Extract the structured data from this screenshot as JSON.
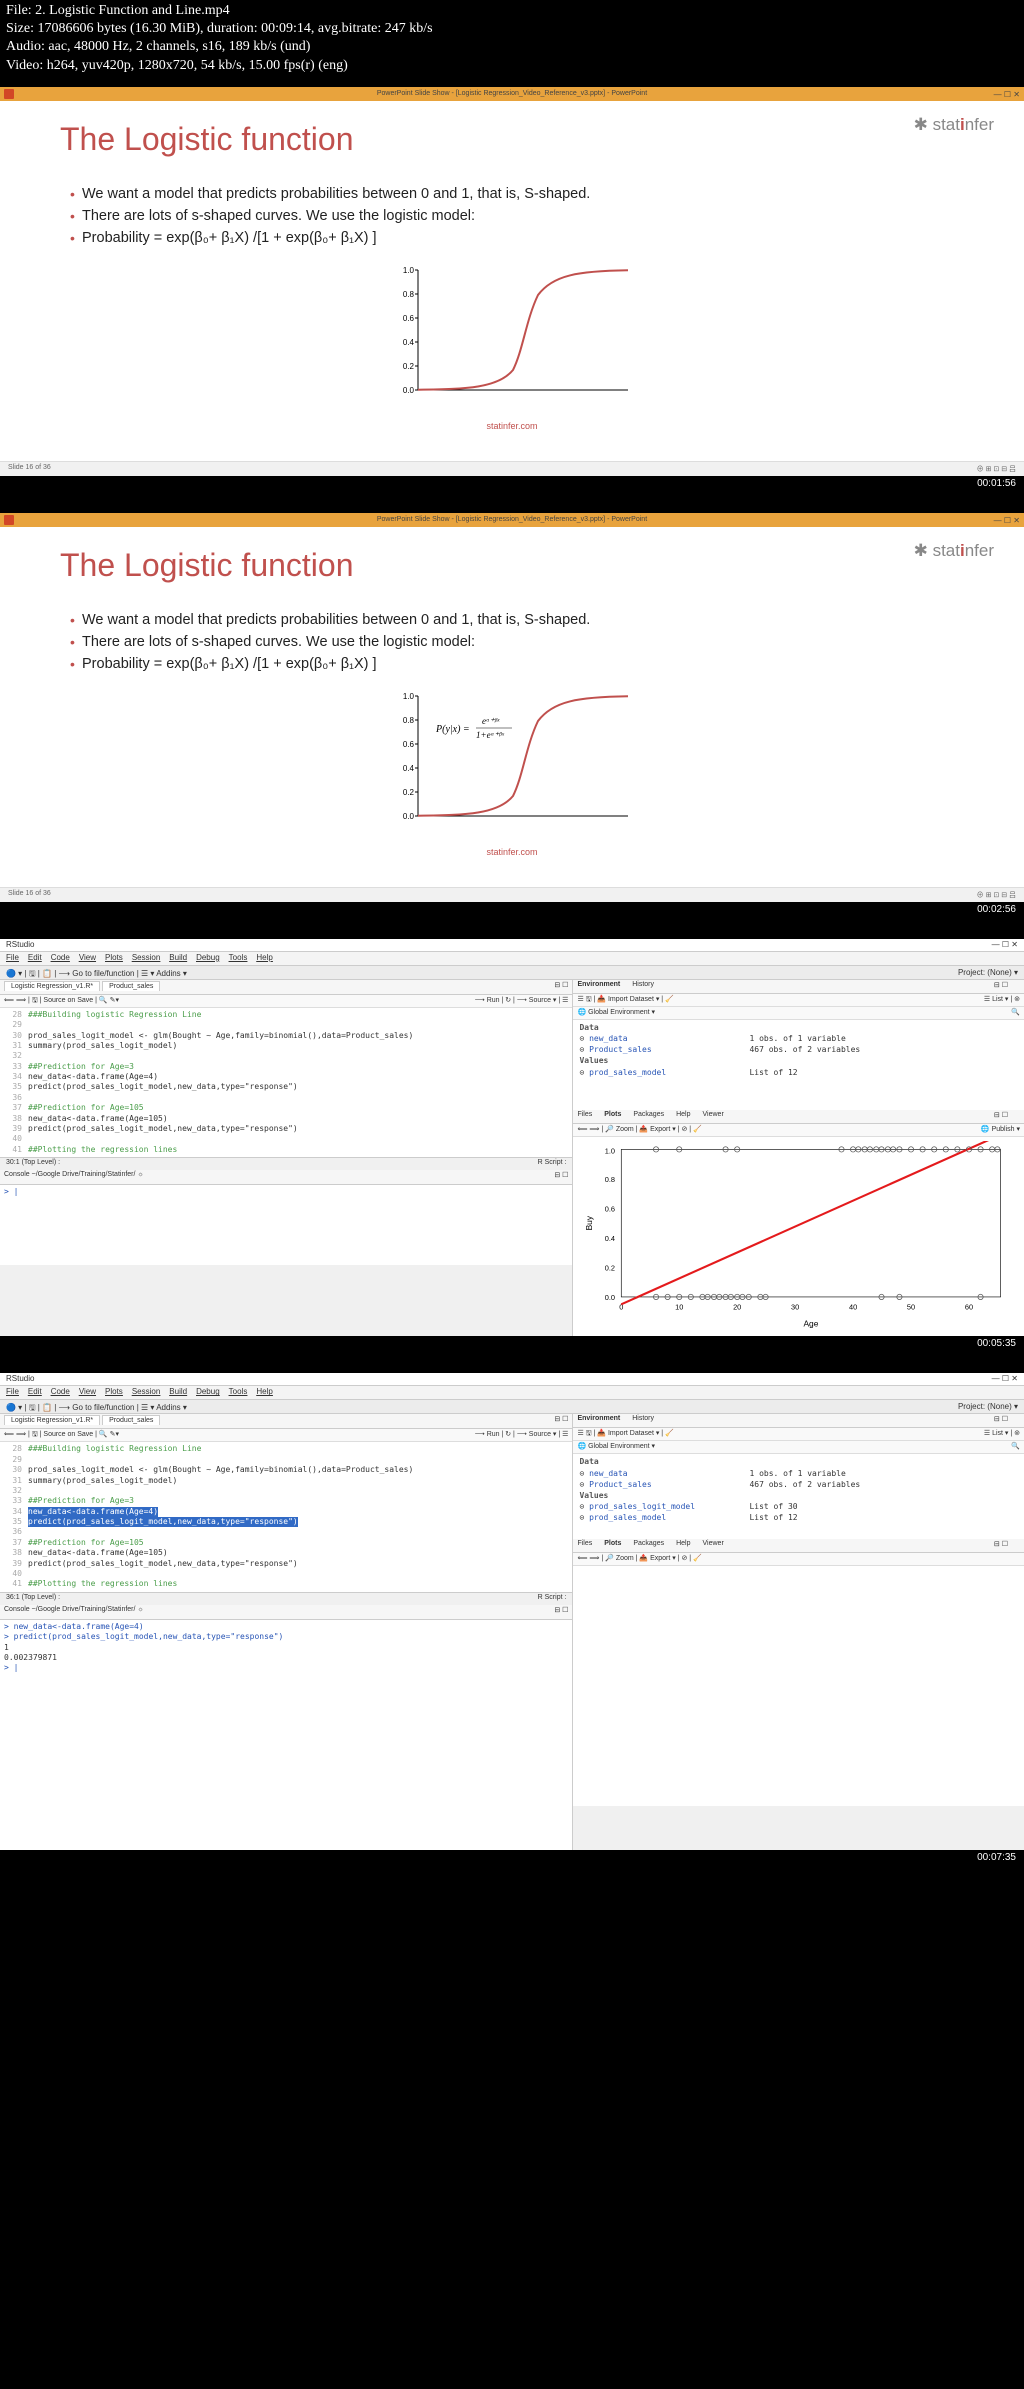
{
  "header": {
    "file": "File: 2. Logistic Function and Line.mp4",
    "size": "Size: 17086606 bytes (16.30 MiB), duration: 00:09:14, avg.bitrate: 247 kb/s",
    "audio": "Audio: aac, 48000 Hz, 2 channels, s16, 189 kb/s (und)",
    "video": "Video: h264, yuv420p, 1280x720, 54 kb/s, 15.00 fps(r) (eng)"
  },
  "ppt": {
    "titlebar": "PowerPoint Slide Show - [Logistic Regression_Video_Reference_v3.pptx] - PowerPoint",
    "win_ctrl": "—  ☐  ✕",
    "logo_pre": "stat",
    "logo_mid": "i",
    "logo_post": "nfer",
    "title": "The Logistic function",
    "b1": "We want a model that predicts probabilities between 0 and 1, that is, S-shaped.",
    "b2": "There are lots of s-shaped curves. We use the logistic model:",
    "b3": "Probability = exp(β₀+ β₁X) /[1 + exp(β₀+ β₁X) ]",
    "caption": "statinfer.com",
    "footer_left": "Slide 16 of 36",
    "footer_right": "⊕ ⊞ ⊡ ⊟ 吕",
    "formula": "P(y|x) = eᵅ⁺ᵝˣ / (1+eᵅ⁺ᵝˣ)"
  },
  "ts": {
    "t1": "00:01:56",
    "t2": "00:02:56",
    "t3": "00:05:35",
    "t4": "00:07:35"
  },
  "rs": {
    "app": "RStudio",
    "proj": "Project: (None) ▾",
    "menu": [
      "File",
      "Edit",
      "Code",
      "View",
      "Plots",
      "Session",
      "Build",
      "Debug",
      "Tools",
      "Help"
    ],
    "toolbar": "🔵 ▾ | 🖫 | 📋 | ⟶ Go to file/function   | ☰ ▾ Addins ▾",
    "tab1": "Logistic Regression_v1.R*",
    "tab2": "Product_sales",
    "subtool_left": "⟸ ⟹ | 🖫 | Source on Save | 🔍 ✎▾",
    "subtool_right": "⟶ Run | ↻ | ⟶ Source ▾ | ☰",
    "code_lines": [
      {
        "n": 28,
        "t": "###Building logistic Regression Line",
        "cls": "rs-green"
      },
      {
        "n": 29,
        "t": ""
      },
      {
        "n": 30,
        "t": "prod_sales_logit_model <- glm(Bought ~ Age,family=binomial(),data=Product_sales)"
      },
      {
        "n": 31,
        "t": "summary(prod_sales_logit_model)"
      },
      {
        "n": 32,
        "t": ""
      },
      {
        "n": 33,
        "t": "##Prediction for Age=3",
        "cls": "rs-green"
      },
      {
        "n": 34,
        "t": "new_data<-data.frame(Age=4)"
      },
      {
        "n": 35,
        "t": "predict(prod_sales_logit_model,new_data,type=\"response\")"
      },
      {
        "n": 36,
        "t": ""
      },
      {
        "n": 37,
        "t": "##Prediction for Age=105",
        "cls": "rs-green"
      },
      {
        "n": 38,
        "t": "new_data<-data.frame(Age=105)"
      },
      {
        "n": 39,
        "t": "predict(prod_sales_logit_model,new_data,type=\"response\")"
      },
      {
        "n": 40,
        "t": ""
      },
      {
        "n": 41,
        "t": "##Plotting the regression lines",
        "cls": "rs-green"
      }
    ],
    "code_footer_l": "30:1  (Top Level) :",
    "code_footer_r": "R Script :",
    "console_tab": "Console  ~/Google Drive/Training/Statinfer/ ☼",
    "console_prompt": "> |",
    "env_tabs": [
      "Environment",
      "History"
    ],
    "env_tool_l": "☰ 🖫 | 📥 Import Dataset ▾ | 🧹",
    "env_tool_r": "☰ List ▾ | ⊚",
    "env_scope": "🌐 Global Environment ▾",
    "env1": {
      "data_hdr": "Data",
      "new_data": "new_data",
      "new_data_d": "1 obs. of 1 variable",
      "prod": "Product_sales",
      "prod_d": "467 obs. of 2 variables",
      "val_hdr": "Values",
      "model": "prod_sales_model",
      "model_d": "List of 12"
    },
    "env2": {
      "new_data": "new_data",
      "new_data_d": "1 obs. of 1 variable",
      "prod": "Product_sales",
      "prod_d": "467 obs. of 2 variables",
      "val_hdr": "Values",
      "logit": "prod_sales_logit_model",
      "logit_d": "List of 30",
      "model": "prod_sales_model",
      "model_d": "List of 12"
    },
    "plot_tabs": [
      "Files",
      "Plots",
      "Packages",
      "Help",
      "Viewer"
    ],
    "plot_tool_l": "⟸ ⟹ | 🔎 Zoom | 📤 Export ▾ | ⊘ | 🧹",
    "plot_tool_r": "🌐 Publish ▾",
    "plot_xlabel": "Age",
    "plot_ylabel": "Buy",
    "console2": {
      "l1": "> new_data<-data.frame(Age=4)",
      "l2": "> predict(prod_sales_logit_model,new_data,type=\"response\")",
      "l3": "           1",
      "l4": "0.002379871",
      "l5": "> |"
    }
  },
  "chart_data": [
    {
      "type": "line",
      "name": "logistic-curve-slide1",
      "title": "Logistic function",
      "xlim": [
        -6,
        6
      ],
      "ylim": [
        0,
        1
      ],
      "yticks": [
        0.0,
        0.2,
        0.4,
        0.6,
        0.8,
        1.0
      ],
      "series": [
        {
          "name": "sigmoid",
          "x": [
            -6,
            -4,
            -2,
            -1,
            0,
            1,
            2,
            4,
            6
          ],
          "y": [
            0.002,
            0.018,
            0.119,
            0.269,
            0.5,
            0.731,
            0.881,
            0.982,
            0.998
          ]
        }
      ]
    },
    {
      "type": "line",
      "name": "logistic-curve-slide2",
      "formula": "P(y|x) = e^(a+bx)/(1+e^(a+bx))",
      "xlim": [
        -6,
        6
      ],
      "ylim": [
        0,
        1
      ],
      "yticks": [
        0.0,
        0.2,
        0.4,
        0.6,
        0.8,
        1.0
      ],
      "series": [
        {
          "name": "sigmoid",
          "x": [
            -6,
            -4,
            -2,
            -1,
            0,
            1,
            2,
            4,
            6
          ],
          "y": [
            0.002,
            0.018,
            0.119,
            0.269,
            0.5,
            0.731,
            0.881,
            0.982,
            0.998
          ]
        }
      ]
    },
    {
      "type": "scatter",
      "name": "rstudio-buy-age",
      "xlabel": "Age",
      "ylabel": "Buy",
      "xlim": [
        0,
        65
      ],
      "ylim": [
        0,
        1
      ],
      "xticks": [
        0,
        10,
        20,
        30,
        40,
        50,
        60
      ],
      "yticks": [
        0.0,
        0.2,
        0.4,
        0.6,
        0.8,
        1.0
      ],
      "series": [
        {
          "name": "points-low",
          "y": 0,
          "x": [
            6,
            8,
            10,
            12,
            14,
            15,
            16,
            17,
            18,
            19,
            20,
            21,
            22,
            24,
            25,
            45,
            48,
            62
          ]
        },
        {
          "name": "points-high",
          "y": 1,
          "x": [
            6,
            10,
            18,
            20,
            38,
            40,
            41,
            42,
            43,
            44,
            45,
            46,
            47,
            48,
            50,
            52,
            54,
            56,
            58,
            60,
            62,
            64,
            65
          ]
        },
        {
          "name": "fit-line",
          "type": "line",
          "x": [
            0,
            65
          ],
          "y": [
            -0.05,
            1.12
          ]
        }
      ]
    }
  ]
}
